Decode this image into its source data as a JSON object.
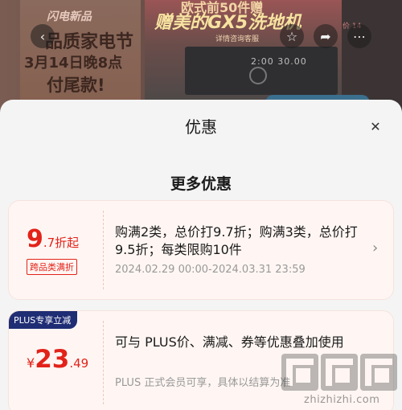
{
  "background": {
    "promo_top": "闪电新品",
    "promo_title": "品质家电节",
    "promo_date": "3月14日晚8点",
    "promo_final": "付尾款!",
    "ad_line1": "欧式前50件赠",
    "ad_line2": "赠美的GX5洗地机",
    "ad_line3": "详情咨询客服",
    "oven_display": "2:00 30.00",
    "strip_text": "价\n14",
    "back_icon": "chevron-left-icon",
    "star_icon": "star-icon",
    "share_icon": "share-icon",
    "more_icon": "more-icon"
  },
  "sheet": {
    "title": "优惠",
    "close_glyph": "✕",
    "section_title": "更多优惠"
  },
  "coupons": [
    {
      "discount_big": "9",
      "discount_small": ".7折起",
      "tag": "跨品类满折",
      "description": "购满2类，总价打9.7折；购满3类，总价打9.5折；每类限购10件",
      "date_range": "2024.02.29 00:00-2024.03.31 23:59",
      "chevron": "›"
    },
    {
      "badge": "PLUS专享立减",
      "currency": "¥",
      "price_int": "23",
      "price_dec": ".49",
      "description": "可与 PLUS价、满减、券等优惠叠加使用",
      "subtext": "PLUS 正式会员可享，具体以结算为准"
    }
  ],
  "watermark": {
    "text": "zhizhizhi.com"
  }
}
